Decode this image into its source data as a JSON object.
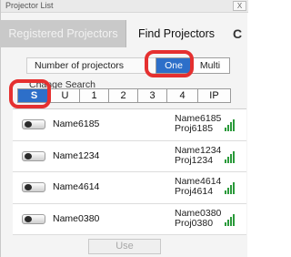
{
  "window": {
    "title": "Projector List",
    "close_label": "X"
  },
  "tabs": [
    {
      "label": "Registered Projectors"
    },
    {
      "label": "Find Projectors"
    },
    {
      "label": "C"
    }
  ],
  "count": {
    "label": "Number of projectors",
    "option_one": "One",
    "option_multi": "Multi",
    "selected": "One"
  },
  "search": {
    "label": "Change Search",
    "options": [
      "S",
      "U",
      "1",
      "2",
      "3",
      "4",
      "IP"
    ],
    "selected": "S"
  },
  "projectors": [
    {
      "name": "Name6185",
      "detail_name": "Name6185",
      "detail_proj": "Proj6185",
      "signal_icon": "signal-strength-icon"
    },
    {
      "name": "Name1234",
      "detail_name": "Name1234",
      "detail_proj": "Proj1234",
      "signal_icon": "signal-strength-icon"
    },
    {
      "name": "Name4614",
      "detail_name": "Name4614",
      "detail_proj": "Proj4614",
      "signal_icon": "signal-strength-icon"
    },
    {
      "name": "Name0380",
      "detail_name": "Name0380",
      "detail_proj": "Proj0380",
      "signal_icon": "signal-strength-icon"
    }
  ],
  "footer": {
    "use_label": "Use"
  },
  "colors": {
    "accent": "#2d6fc9",
    "highlight": "#e53030",
    "signal": "#2a9a3a"
  }
}
